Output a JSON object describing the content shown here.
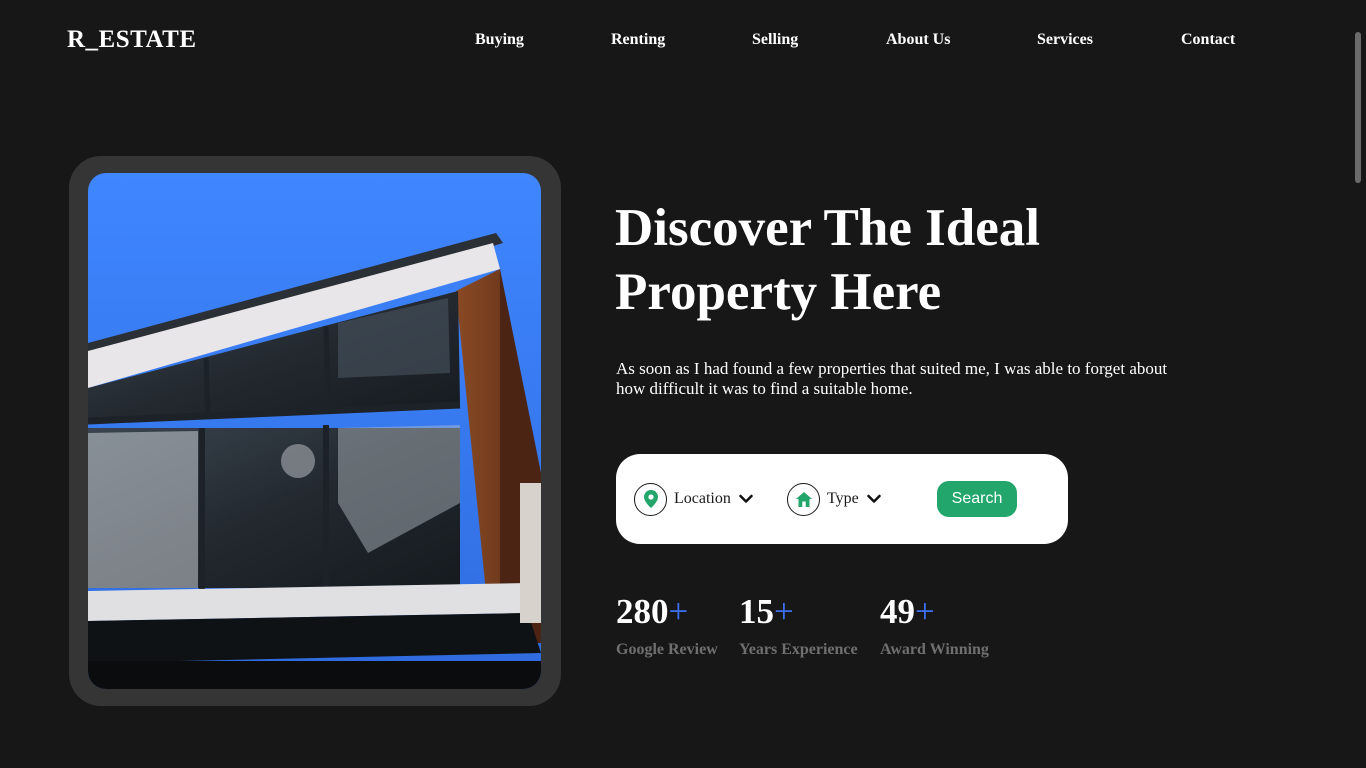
{
  "header": {
    "logo": "R_ESTATE",
    "nav": [
      "Buying",
      "Renting",
      "Selling",
      "About Us",
      "Services",
      "Contact"
    ]
  },
  "hero": {
    "title_line1": "Discover The Ideal",
    "title_line2": "Property Here",
    "description": "As soon as I had found a few properties that suited me, I was able to forget about how difficult it was to find a suitable home.",
    "image_icon": "modern-house-photo"
  },
  "search": {
    "location_label": "Location",
    "location_icon": "map-pin-icon",
    "type_label": "Type",
    "type_icon": "home-icon",
    "button_label": "Search"
  },
  "stats": [
    {
      "value": "280",
      "suffix": "+",
      "label": "Google Review"
    },
    {
      "value": "15",
      "suffix": "+",
      "label": "Years Experience"
    },
    {
      "value": "49",
      "suffix": "+",
      "label": "Award Winning"
    }
  ],
  "colors": {
    "background": "#171717",
    "accent_green": "#22a66b",
    "accent_blue": "#3d6ff5",
    "muted_text": "#6f6f6f"
  }
}
